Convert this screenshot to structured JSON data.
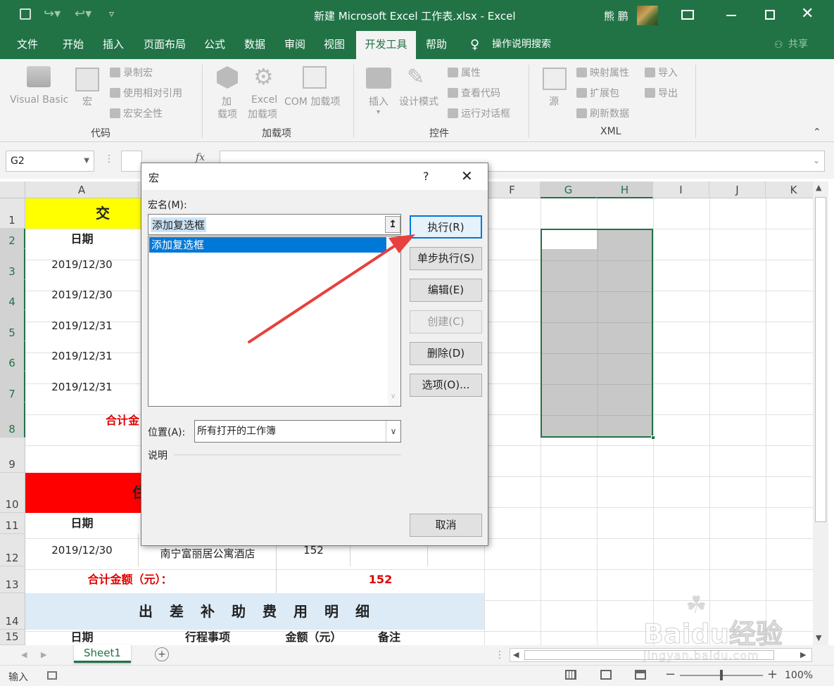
{
  "window": {
    "title": "新建 Microsoft Excel 工作表.xlsx  -  Excel",
    "user": "熊 鹏"
  },
  "tabs": [
    "文件",
    "开始",
    "插入",
    "页面布局",
    "公式",
    "数据",
    "审阅",
    "视图",
    "开发工具",
    "帮助"
  ],
  "active_tab": "开发工具",
  "tell_me": "操作说明搜索",
  "share": "共享",
  "ribbon": {
    "code": {
      "label": "代码",
      "visual_basic": "Visual Basic",
      "macros": "宏",
      "record_macro": "录制宏",
      "relative_ref": "使用相对引用",
      "macro_security": "宏安全性"
    },
    "addins": {
      "label": "加载项",
      "addins_l1": "加",
      "addins_l2": "载项",
      "excel_addins_l1": "Excel",
      "excel_addins_l2": "加载项",
      "com_addins": "COM 加载项"
    },
    "controls": {
      "label": "控件",
      "insert": "插入",
      "design_mode": "设计模式",
      "properties": "属性",
      "view_code": "查看代码",
      "run_dialog": "运行对话框"
    },
    "xml": {
      "label": "XML",
      "source": "源",
      "map_properties": "映射属性",
      "expansion_packs": "扩展包",
      "refresh_data": "刷新数据",
      "import": "导入",
      "export": "导出"
    }
  },
  "formula_bar": {
    "name_box": "G2",
    "fx": "fx",
    "content": ""
  },
  "columns": [
    "A",
    "F",
    "G",
    "H",
    "I",
    "J",
    "K"
  ],
  "rows": [
    "1",
    "2",
    "3",
    "4",
    "5",
    "6",
    "7",
    "8",
    "9",
    "10",
    "11",
    "12",
    "13",
    "14",
    "15"
  ],
  "sheet": {
    "title1": "交",
    "date_header": "日期",
    "dates": [
      "2019/12/30",
      "2019/12/30",
      "2019/12/31",
      "2019/12/31",
      "2019/12/31"
    ],
    "total_partial": "合计金",
    "title2_partial": "住",
    "date_header2": "日期",
    "r12_date": "2019/12/30",
    "r12_place": "南宁富丽居公寓酒店",
    "r12_amount": "152",
    "r13_label": "合计金额（元）：",
    "r13_value": "152",
    "r14_title": "出　差　补　助　费　用　明　细",
    "r15_date": "日期",
    "r15_item": "行程事项",
    "r15_amount": "金额（元）",
    "r15_note": "备注"
  },
  "dialog": {
    "title": "宏",
    "help": "?",
    "macro_name_label": "宏名(M):",
    "macro_name_value": "添加复选框",
    "macro_list": [
      "添加复选框"
    ],
    "buttons": {
      "run": "执行(R)",
      "step_into": "单步执行(S)",
      "edit": "编辑(E)",
      "create": "创建(C)",
      "delete": "删除(D)",
      "options": "选项(O)...",
      "cancel": "取消"
    },
    "location_label": "位置(A):",
    "location_value": "所有打开的工作簿",
    "description_label": "说明"
  },
  "sheet_tab": "Sheet1",
  "status": {
    "mode": "输入",
    "zoom": "100%"
  },
  "watermark": {
    "logo": "Baidu经验",
    "url": "jingyan.baidu.com"
  },
  "colors": {
    "excel_green": "#217346",
    "yellow": "#ffff00",
    "red": "#ff0000",
    "light_blue": "#ddebf7",
    "red_text": "#e00000",
    "selection_gray": "#c8c8c8",
    "arrow": "#e8403c"
  }
}
